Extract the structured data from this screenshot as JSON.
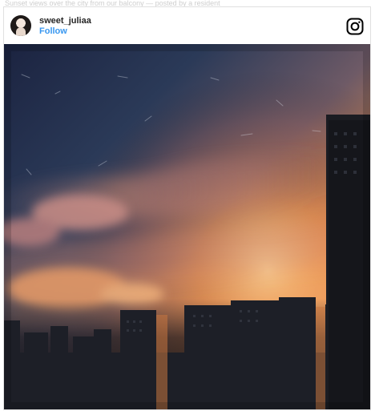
{
  "top_hint": "Sunset views over the city from our balcony — posted by a resident",
  "post": {
    "username": "sweet_juliaa",
    "follow_label": "Follow",
    "platform_icon": "instagram-icon",
    "avatar_icon": "avatar"
  },
  "colors": {
    "follow_blue": "#3897f0",
    "username_text": "#262626",
    "card_border": "#e0e0e0",
    "sky_top": "#1c2340",
    "sunset_orange": "#f2964f"
  }
}
